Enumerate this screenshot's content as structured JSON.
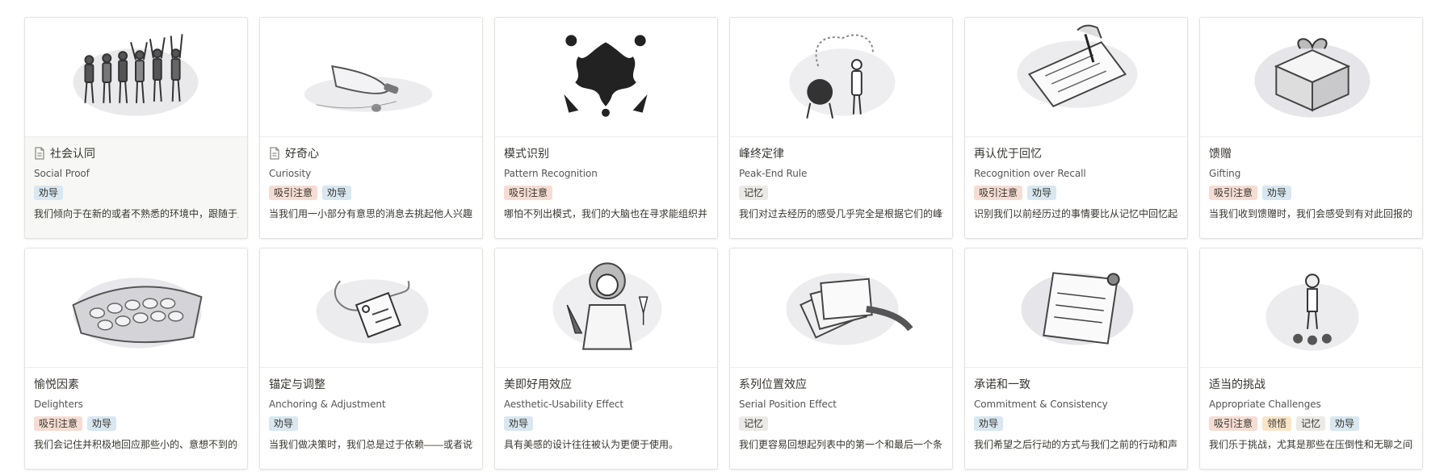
{
  "tag_colors": {
    "吸引注意": "#f5ddd3",
    "劝导": "#d8e7f0",
    "记忆": "#ebeae7",
    "领悟": "#f8e6c9"
  },
  "cards": [
    {
      "title": "社会认同",
      "subtitle": "Social Proof",
      "tags": [
        "劝导"
      ],
      "description": "我们倾向于在新的或者不熟悉的环境中，跟随于周",
      "page_icon": true,
      "illustration": "crowd-cheering-illustration"
    },
    {
      "title": "好奇心",
      "subtitle": "Curiosity",
      "tags": [
        "吸引注意",
        "劝导"
      ],
      "description": "当我们用一小部分有意思的消息去挑起他人兴趣时",
      "page_icon": true,
      "illustration": "message-bottle-illustration"
    },
    {
      "title": "模式识别",
      "subtitle": "Pattern Recognition",
      "tags": [
        "吸引注意"
      ],
      "description": "哪怕不列出模式，我们的大脑也在寻求能组织并简",
      "page_icon": false,
      "illustration": "inkblot-illustration"
    },
    {
      "title": "峰终定律",
      "subtitle": "Peak-End Rule",
      "tags": [
        "记忆"
      ],
      "description": "我们对过去经历的感受几乎完全是根据它们的峰值",
      "page_icon": false,
      "illustration": "chef-cooking-illustration"
    },
    {
      "title": "再认优于回忆",
      "subtitle": "Recognition over Recall",
      "tags": [
        "吸引注意",
        "劝导"
      ],
      "description": "识别我们以前经历过的事情要比从记忆中回忆起来",
      "page_icon": false,
      "illustration": "signing-document-illustration"
    },
    {
      "title": "馈赠",
      "subtitle": "Gifting",
      "tags": [
        "吸引注意",
        "劝导"
      ],
      "description": "当我们收到馈赠时，我们会感受到有对此回报的需",
      "page_icon": false,
      "illustration": "gift-box-illustration"
    },
    {
      "title": "愉悦因素",
      "subtitle": "Delighters",
      "tags": [
        "吸引注意",
        "劝导"
      ],
      "description": "我们会记住并积极地回应那些小的、意想不到的并",
      "page_icon": false,
      "illustration": "bubble-wrap-illustration"
    },
    {
      "title": "锚定与调整",
      "subtitle": "Anchoring & Adjustment",
      "tags": [
        "劝导"
      ],
      "description": "当我们做决策时，我们总是过于依赖——或者说锚",
      "page_icon": false,
      "illustration": "sale-tag-illustration"
    },
    {
      "title": "美即好用效应",
      "subtitle": "Aesthetic-Usability Effect",
      "tags": [
        "劝导"
      ],
      "description": "具有美感的设计往往被认为更便于使用。",
      "page_icon": false,
      "illustration": "woman-toasting-illustration"
    },
    {
      "title": "系列位置效应",
      "subtitle": "Serial Position Effect",
      "tags": [
        "记忆"
      ],
      "description": "我们更容易回想起列表中的第一个和最后一个条目",
      "page_icon": false,
      "illustration": "resume-cards-illustration"
    },
    {
      "title": "承诺和一致",
      "subtitle": "Commitment & Consistency",
      "tags": [
        "劝导"
      ],
      "description": "我们希望之后行动的方式与我们之前的行动和声明",
      "page_icon": false,
      "illustration": "pinned-note-illustration"
    },
    {
      "title": "适当的挑战",
      "subtitle": "Appropriate Challenges",
      "tags": [
        "吸引注意",
        "领悟",
        "记忆",
        "劝导"
      ],
      "description": "我们乐于挑战，尤其是那些在压倒性和无聊之间取",
      "page_icon": false,
      "illustration": "juggler-illustration"
    }
  ]
}
